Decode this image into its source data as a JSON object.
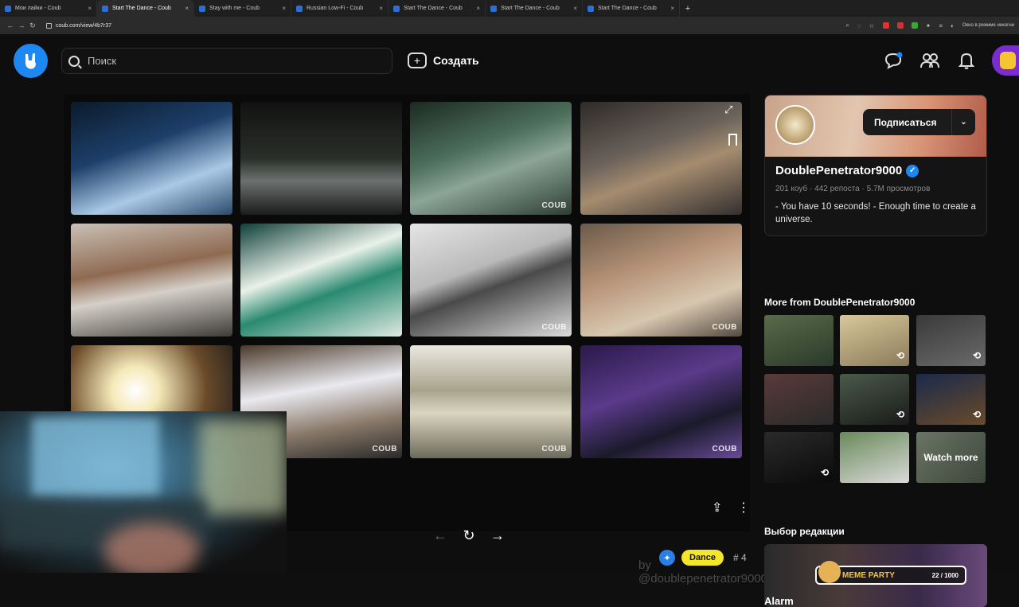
{
  "browser": {
    "tabs": [
      {
        "label": "Мои лайки - Coub",
        "active": false
      },
      {
        "label": "Start The Dance - Coub",
        "active": true
      },
      {
        "label": "Stay with me - Coub",
        "active": false
      },
      {
        "label": "Russian Low-Fi - Coub",
        "active": false
      },
      {
        "label": "Start The Dance - Coub",
        "active": false
      },
      {
        "label": "Start The Dance - Coub",
        "active": false
      },
      {
        "label": "Start The Dance - Coub",
        "active": false
      }
    ],
    "tab_close": "×",
    "new_tab": "+",
    "url": "coub.com/view/4b7r37",
    "incognito": "Окно в режиме инкогни"
  },
  "header": {
    "search_placeholder": "Поиск",
    "create_label": "Создать",
    "create_symbol": "+"
  },
  "player": {
    "watermark": "COUB",
    "byline": "by @doublepenetrator9000",
    "pager": {
      "prev": "←",
      "replay": "↻",
      "next": "→"
    },
    "expand_symbol": "⤢",
    "thumbnails": [
      {
        "bg": "linear-gradient(160deg,#0b1a2a 0%,#1d3f6a 40%,#a9c9e6 70%,#2b4a6a 100%)",
        "wm": false
      },
      {
        "bg": "linear-gradient(180deg,#111 0%,#2a2f2a 50%,#6c7170 70%,#1b1b1b 100%)",
        "wm": false
      },
      {
        "bg": "linear-gradient(160deg,#1c2a22 0%,#4d6f5c 40%,#8ba596 60%,#2e3e35 100%)",
        "wm": true
      },
      {
        "bg": "linear-gradient(160deg,#2e2a26 0%,#6a615a 40%,#a58c6f 60%,#343030 100%)",
        "wm": false
      },
      {
        "bg": "linear-gradient(170deg,#c9c0b5 0%,#8f6a52 40%,#d4d0c8 60%,#3e3a36 100%)",
        "wm": false
      },
      {
        "bg": "linear-gradient(160deg,#0f4038 0%,#e9f1ea 40%,#2a8a70 60%,#dfe9e2 100%)",
        "wm": false
      },
      {
        "bg": "linear-gradient(160deg,#e5e5e5 0%,#b9b9b9 40%,#4a4a4a 55%,#dcdcdc 100%)",
        "wm": true
      },
      {
        "bg": "linear-gradient(160deg,#6a5a4a 0%,#b89478 40%,#d7c7b0 70%,#554a40 100%)",
        "wm": true
      },
      {
        "bg": "radial-gradient(circle at 40% 40%,#fff 0%,#f5e9b8 20%,#6a4a2a 60%,#1a1a1a 100%)",
        "wm": false
      },
      {
        "bg": "linear-gradient(170deg,#4a3a2a 0%,#e9e9ef 40%,#8a7a6a 70%,#2a2a2a 100%)",
        "wm": true
      },
      {
        "bg": "linear-gradient(180deg,#eae8e0 0%,#a8a48c 40%,#d9d5c0 60%,#6c6a5a 100%)",
        "wm": true
      },
      {
        "bg": "linear-gradient(160deg,#2a1a4a 0%,#5a3a8a 40%,#1a1a2a 70%,#6a4a9a 100%)",
        "wm": true
      }
    ]
  },
  "actions": {
    "share": "⇪",
    "more": "⋮"
  },
  "tags": {
    "star": "✦",
    "dance": "Dance",
    "count": "# 4"
  },
  "profile": {
    "subscribe": "Подписаться",
    "dropdown": "⌄",
    "name": "DoublePenetrator9000",
    "verified": "✓",
    "stats": "201 коуб · 442 репоста · 5.7M просмотров",
    "bio": "- You have 10 seconds! - Enough time to create a universe."
  },
  "more_from": {
    "title": "More from DoublePenetrator9000",
    "repost_icon": "⟲",
    "watch_more": "Watch more",
    "items": [
      {
        "bg": "linear-gradient(160deg,#5a6a4a,#2a3a2a)",
        "repost": false
      },
      {
        "bg": "linear-gradient(160deg,#d9c89a,#8a7a5a)",
        "repost": true
      },
      {
        "bg": "linear-gradient(160deg,#3a3a3a,#6a6a6a)",
        "repost": true
      },
      {
        "bg": "linear-gradient(160deg,#5a3a3a,#2a2a2a)",
        "repost": false
      },
      {
        "bg": "linear-gradient(160deg,#4a5a4a,#1a1a1a)",
        "repost": true
      },
      {
        "bg": "linear-gradient(160deg,#1a2a4a,#6a4a2a)",
        "repost": true
      },
      {
        "bg": "linear-gradient(160deg,#2a2a2a,#0a0a0a)",
        "repost": true
      },
      {
        "bg": "linear-gradient(160deg,#6a8a5a,#d9d9d9)",
        "repost": false
      }
    ]
  },
  "editor": {
    "title": "Выбор редакции",
    "badge": "MEME PARTY",
    "count": "22 / 1000",
    "item_name": "Alarm"
  }
}
